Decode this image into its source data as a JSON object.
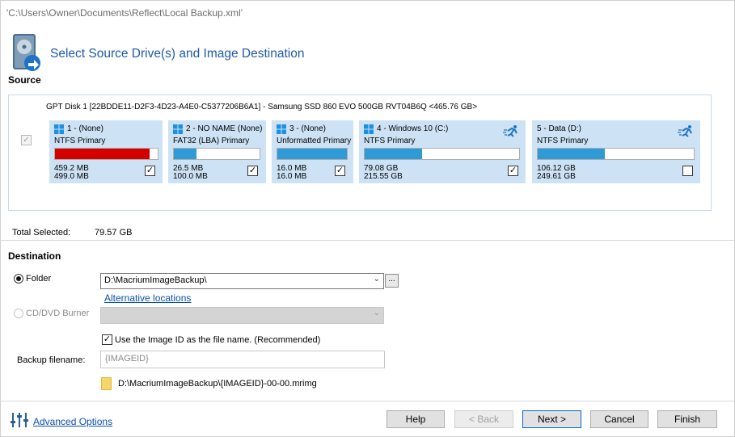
{
  "window": {
    "path_title": "'C:\\Users\\Owner\\Documents\\Reflect\\Local Backup.xml'"
  },
  "wizard": {
    "title": "Select Source Drive(s) and Image Destination"
  },
  "source": {
    "label": "Source",
    "disk_header": "GPT Disk 1 [22BDDE11-D2F3-4D23-A4E0-C5377206B6A1] - Samsung SSD 860 EVO 500GB RVT04B6Q  <465.76 GB>",
    "disk_check": "✓",
    "partitions": [
      {
        "title": "1 -  (None)",
        "fs": "NTFS Primary",
        "used": "459.2 MB",
        "total": "499.0 MB",
        "fill": 0.92,
        "fill_color": "#d40000",
        "check": "✓",
        "icon": "windows-icon"
      },
      {
        "title": "2 - NO NAME (None)",
        "fs": "FAT32 (LBA) Primary",
        "used": "26.5 MB",
        "total": "100.0 MB",
        "fill": 0.26,
        "fill_color": "#2e9bd6",
        "check": "✓",
        "icon": "windows-icon"
      },
      {
        "title": "3 -  (None)",
        "fs": "Unformatted Primary",
        "used": "16.0 MB",
        "total": "16.0 MB",
        "fill": 1.0,
        "fill_color": "#2e9bd6",
        "check": "✓",
        "icon": "windows-icon"
      },
      {
        "title": "4 - Windows 10 (C:)",
        "fs": "NTFS Primary",
        "used": "79.08 GB",
        "total": "215.55 GB",
        "fill": 0.37,
        "fill_color": "#2e9bd6",
        "check": "✓",
        "icon": "windows-icon"
      },
      {
        "title": "5 - Data (D:)",
        "fs": "NTFS Primary",
        "used": "106.12 GB",
        "total": "249.61 GB",
        "fill": 0.43,
        "fill_color": "#2e9bd6",
        "check": "",
        "icon": "windows-icon"
      }
    ]
  },
  "total": {
    "label": "Total Selected:",
    "value": "79.57 GB"
  },
  "destination": {
    "label": "Destination",
    "folder_label": "Folder",
    "folder_value": "D:\\MacriumImageBackup\\",
    "browse_label": "...",
    "alt_locations": "Alternative locations",
    "cd_label": "CD/DVD Burner",
    "use_image_id_label": "Use the Image ID as the file name.  (Recommended)",
    "use_image_id_check": "✓",
    "backup_filename_label": "Backup filename:",
    "backup_filename_value": "{IMAGEID}",
    "resolved_path": "D:\\MacriumImageBackup\\{IMAGEID}-00-00.mrimg"
  },
  "footer": {
    "advanced_options": "Advanced Options",
    "help": "Help",
    "back": "< Back",
    "next": "Next >",
    "cancel": "Cancel",
    "finish": "Finish"
  },
  "colors": {
    "accent": "#1e5aa8",
    "partition_bg": "#cde3f5",
    "bar_blue": "#2e9bd6",
    "bar_red": "#d40000"
  }
}
